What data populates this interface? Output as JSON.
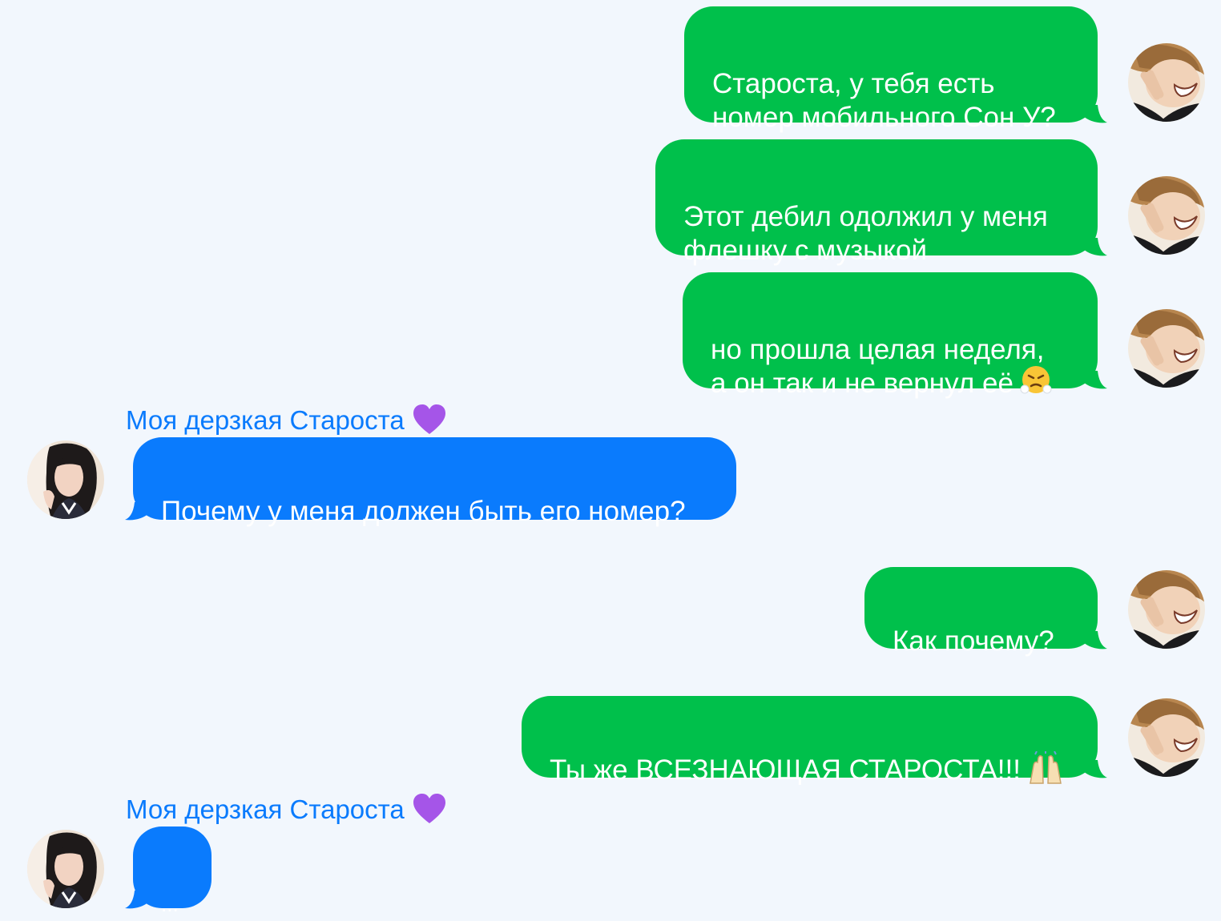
{
  "colors": {
    "background": "#f2f7fd",
    "outgoing_bubble": "#00c04b",
    "incoming_bubble": "#0a7bfd",
    "sender_name": "#0a7bfd",
    "bubble_text": "#ffffff"
  },
  "avatars": {
    "me": "boy-avatar",
    "contact": "girl-avatar"
  },
  "messages": [
    {
      "direction": "outgoing",
      "text": "Староста, у тебя есть\nномер мобильного Сон У?"
    },
    {
      "direction": "outgoing",
      "text": "Этот дебил одолжил у меня\nфлешку с музыкой"
    },
    {
      "direction": "outgoing",
      "text": "но прошла целая неделя,\nа он так и не вернул её",
      "emoji": "steam-face-emoji"
    },
    {
      "direction": "incoming",
      "sender": "Моя дерзкая Староста",
      "sender_emoji": "purple-heart-emoji",
      "text": "Почему у меня должен быть его номер?"
    },
    {
      "direction": "outgoing",
      "text": "Как почему?"
    },
    {
      "direction": "outgoing",
      "text": "Ты же ВСЕЗНАЮЩАЯ СТАРОСТА!!!",
      "emoji": "raised-hands-emoji"
    },
    {
      "direction": "incoming",
      "sender": "Моя дерзкая Староста",
      "sender_emoji": "purple-heart-emoji",
      "text": "..."
    }
  ]
}
